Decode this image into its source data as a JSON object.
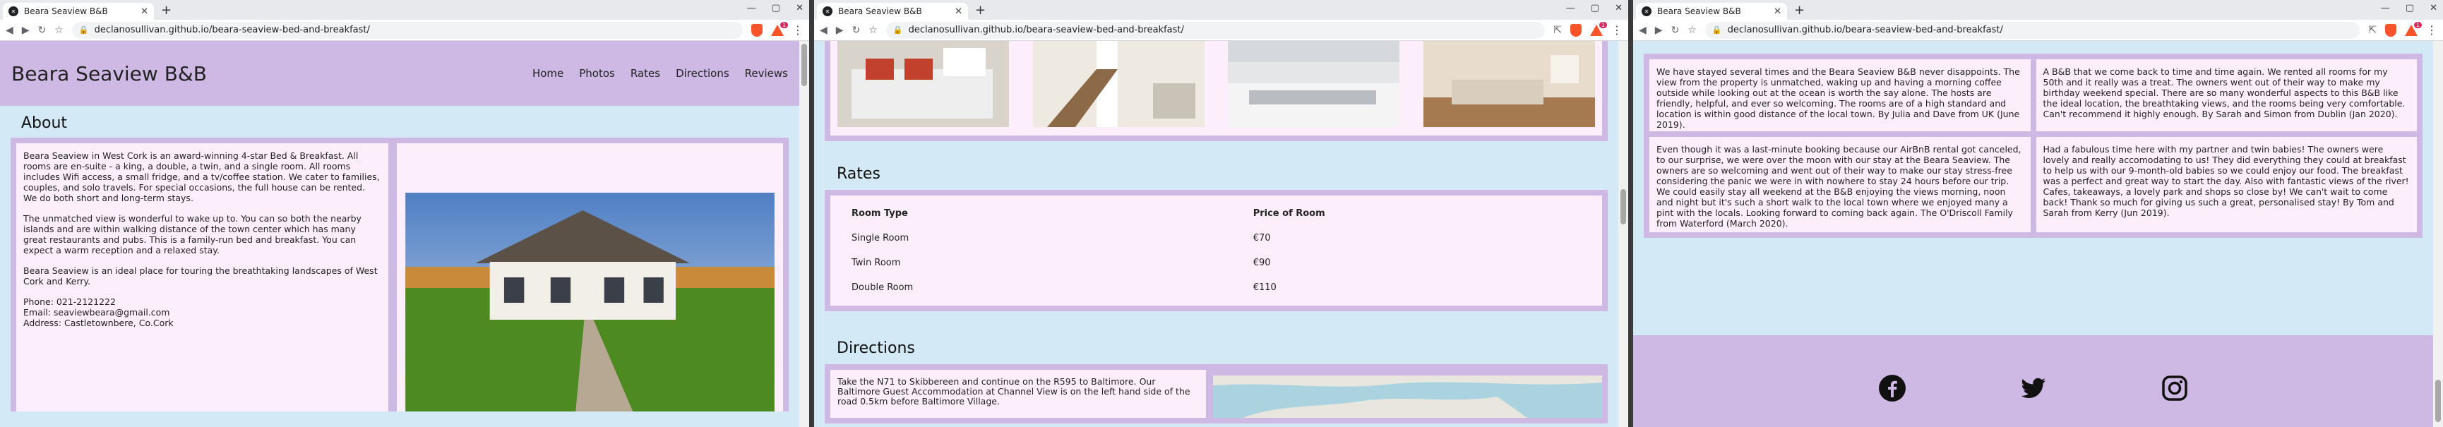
{
  "browser": {
    "tab_title": "Beara Seaview B&B",
    "favicon_label": "✕",
    "new_tab_label": "+",
    "url": "declanosullivan.github.io/beara-seaview-bed-and-breakfast/",
    "alert_count": "1",
    "win_min": "—",
    "win_max": "▢",
    "win_close": "✕"
  },
  "site": {
    "brand": "Beara Seaview B&B",
    "nav": [
      "Home",
      "Photos",
      "Rates",
      "Directions",
      "Reviews"
    ]
  },
  "about": {
    "heading": "About",
    "paragraphs": [
      "Beara Seaview in West Cork is an award-winning 4-star Bed & Breakfast. All rooms are en-suite - a king, a double, a twin, and a single room. All rooms includes Wifi access, a small fridge, and a tv/coffee station. We cater to families, couples, and solo travels. For special occasions, the full house can be rented. We do both short and long-term stays.",
      "The unmatched view is wonderful to wake up to. You can so both the nearby islands and are within walking distance of the town center which has many great restaurants and pubs. This is a family-run bed and breakfast. You can expect a warm reception and a relaxed stay.",
      "Beara Seaview is an ideal place for touring the breathtaking landscapes of West Cork and Kerry."
    ],
    "contact": [
      "Phone: 021-2121222",
      "Email: seaviewbeara@gmail.com",
      "Address: Castletownbere, Co.Cork"
    ]
  },
  "rates": {
    "heading": "Rates",
    "col_type": "Room Type",
    "col_price": "Price of Room",
    "rows": [
      {
        "room": "Single Room",
        "price": "€70"
      },
      {
        "room": "Twin Room",
        "price": "€90"
      },
      {
        "room": "Double Room",
        "price": "€110"
      }
    ]
  },
  "directions": {
    "heading": "Directions",
    "text": "Take the N71 to Skibbereen and continue on the R595 to Baltimore. Our Baltimore Guest Accommodation at Channel View is on the left hand side of the road 0.5km before Baltimore Village."
  },
  "reviews": [
    "We have stayed several times and the Beara Seaview B&B never disappoints. The view from the property is unmatched, waking up and having a morning coffee outside while looking out at the ocean is worth the say alone. The hosts are friendly, helpful, and ever so welcoming. The rooms are of a high standard and location is within good distance of the local town. By Julia and Dave from UK (June 2019).",
    "A B&B that we come back to time and time again. We rented all rooms for my 50th and it really was a treat. The owners went out of their way to make my birthday weekend special. There are so many wonderful aspects to this B&B like the ideal location, the breathtaking views, and the rooms being very comfortable. Can't recommend it highly enough. By Sarah and Simon from Dublin (Jan 2020).",
    "Even though it was a last-minute booking because our AirBnB rental got canceled, to our surprise, we were over the moon with our stay at the Beara Seaview. The owners are so welcoming and went out of their way to make our stay stress-free considering the panic we were in with nowhere to stay 24 hours before our trip. We could easily stay all weekend at the B&B enjoying the views morning, noon and night but it's such a short walk to the local town where we enjoyed many a pint with the locals. Looking forward to coming back again. The O'Driscoll Family from Waterford (March 2020).",
    "Had a fabulous time here with my partner and twin babies! The owners were lovely and really accomodating to us! They did everything they could at breakfast to help us with our 9-month-old babies so we could enjoy our food. The breakfast was a perfect and great way to start the day. Also with fantastic views of the river! Cafes, takeaways, a lovely park and shops so close by! We can't wait to come back! Thank so much for giving us such a great, personalised stay! By Tom and Sarah from Kerry (Jun 2019)."
  ],
  "footer": {
    "icons": [
      "facebook-icon",
      "twitter-icon",
      "instagram-icon"
    ]
  },
  "colors": {
    "header_purple": "#cdb9e4",
    "page_blue": "#d4e9f6",
    "panel_pink": "#fdeefc"
  }
}
